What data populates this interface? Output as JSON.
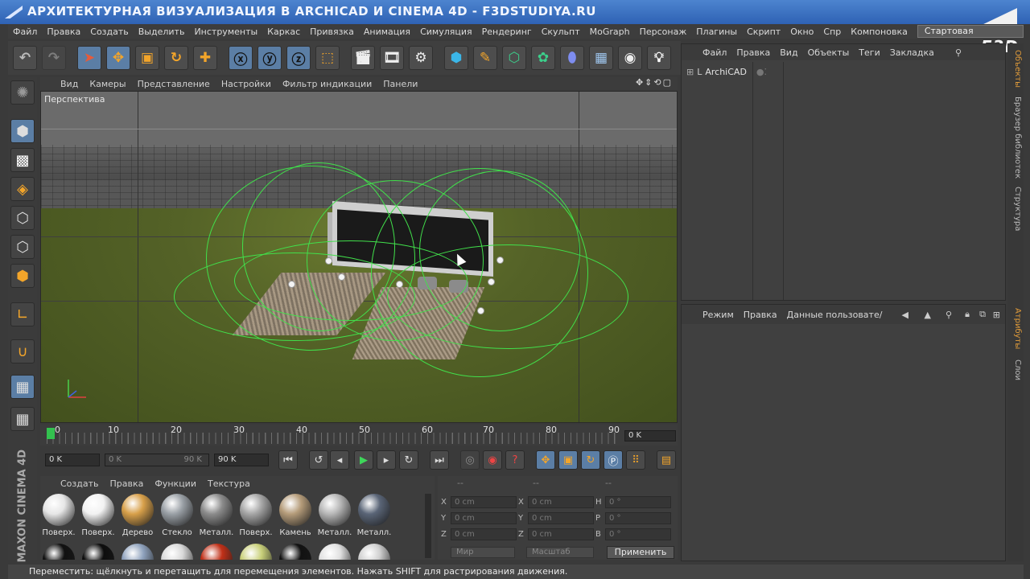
{
  "title": "АРХИТЕКТУРНАЯ ВИЗУАЛИЗАЦИЯ В ARCHICAD И CINEMA 4D - F3DSTUDIYA.RU",
  "watermark": "F3D",
  "menu": [
    "Файл",
    "Правка",
    "Создать",
    "Выделить",
    "Инструменты",
    "Каркас",
    "Привязка",
    "Анимация",
    "Симуляция",
    "Рендеринг",
    "Скульпт",
    "MoGraph",
    "Персонаж",
    "Плагины",
    "Скрипт",
    "Окно",
    "Спр",
    "Компоновка"
  ],
  "layout_value": "Стартовая",
  "viewport": {
    "menu": [
      "Вид",
      "Камеры",
      "Представление",
      "Настройки",
      "Фильтр индикации",
      "Панели"
    ],
    "label": "Перспектива"
  },
  "timeline": {
    "ticks": [
      "0",
      "10",
      "20",
      "30",
      "40",
      "50",
      "60",
      "70",
      "80",
      "90"
    ],
    "frame": "0 K"
  },
  "transport": {
    "start": "0 K",
    "range_start": "0 K",
    "range_end": "90 K",
    "end": "90 K"
  },
  "materials": {
    "menu": [
      "Создать",
      "Правка",
      "Функции",
      "Текстура"
    ],
    "items": [
      {
        "label": "Поверх.",
        "color": "#e6e6e6"
      },
      {
        "label": "Поверх.",
        "color": "#f2f2f2"
      },
      {
        "label": "Дерево",
        "color": "#d8a04a"
      },
      {
        "label": "Стекло",
        "color": "#9aa0a6"
      },
      {
        "label": "Металл.",
        "color": "#8c8c8c"
      },
      {
        "label": "Поверх.",
        "color": "#a6a6a6"
      },
      {
        "label": "Камень",
        "color": "#b59c7a"
      },
      {
        "label": "Металл.",
        "color": "#b7b7b7"
      },
      {
        "label": "Металл.",
        "color": "#5a6577"
      }
    ],
    "row2_colors": [
      "#111111",
      "#0d0d0d",
      "#8fa2bd",
      "#d9d9d9",
      "#c03018",
      "#c9d07a",
      "#121212",
      "#e0e0e0",
      "#cfcfcf"
    ]
  },
  "coords": {
    "header": [
      "--",
      "--",
      "--"
    ],
    "rows": [
      {
        "l1": "X",
        "v1": "0 cm",
        "l2": "X",
        "v2": "0 cm",
        "l3": "H",
        "v3": "0 °"
      },
      {
        "l1": "Y",
        "v1": "0 cm",
        "l2": "Y",
        "v2": "0 cm",
        "l3": "P",
        "v3": "0 °"
      },
      {
        "l1": "Z",
        "v1": "0 cm",
        "l2": "Z",
        "v2": "0 cm",
        "l3": "B",
        "v3": "0 °"
      }
    ],
    "space": "Мир",
    "scale": "Масштаб",
    "apply": "Применить"
  },
  "objects": {
    "menu": [
      "Файл",
      "Правка",
      "Вид",
      "Объекты",
      "Теги",
      "Закладка"
    ],
    "item": "ArchiCAD"
  },
  "attributes": {
    "menu": [
      "Режим",
      "Правка",
      "Данные пользовате/"
    ]
  },
  "side_tabs": [
    "Объекты",
    "Браузер библиотек",
    "Структура",
    "Атрибуты",
    "Слои"
  ],
  "branding": "MAXON CINEMA 4D",
  "status": "Переместить: щёлкнуть и перетащить для перемещения элементов. Нажать SHIFT для растрирования движения."
}
